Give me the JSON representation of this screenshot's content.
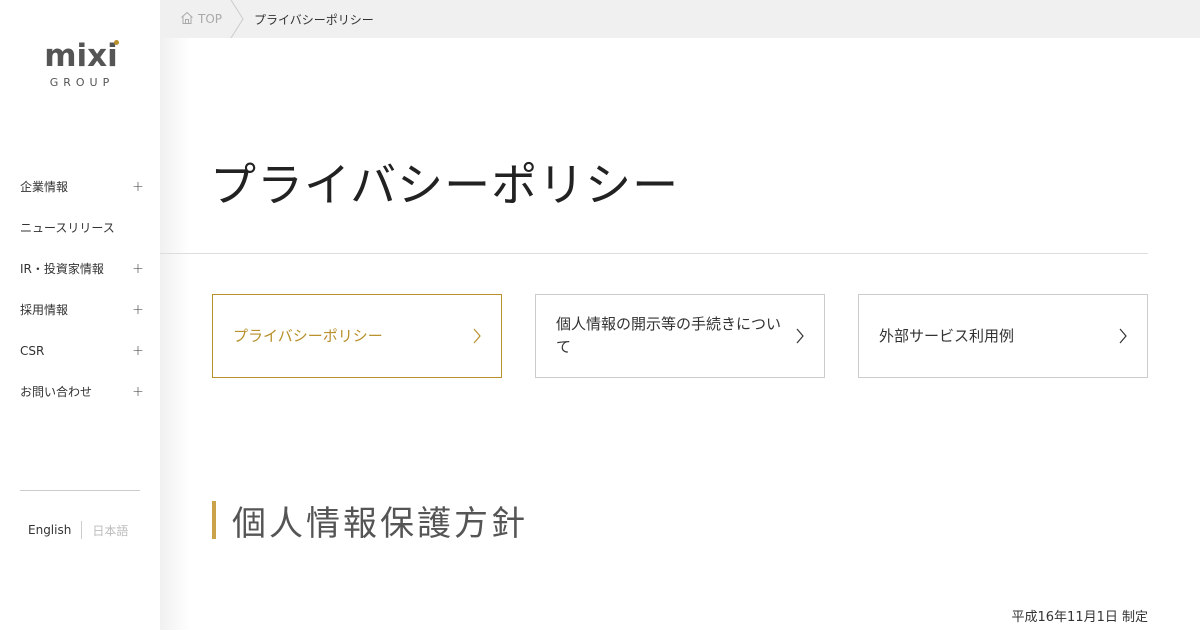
{
  "logo": {
    "main": "mixi",
    "sub": "GROUP",
    "dot_color": "#b8902c"
  },
  "sidebar": {
    "items": [
      {
        "label": "企業情報",
        "expand": "+"
      },
      {
        "label": "ニュースリリース",
        "expand": ""
      },
      {
        "label": "IR・投資家情報",
        "expand": "+"
      },
      {
        "label": "採用情報",
        "expand": "+"
      },
      {
        "label": "CSR",
        "expand": "+"
      },
      {
        "label": "お問い合わせ",
        "expand": "+"
      }
    ],
    "lang": {
      "english": "English",
      "japanese": "日本語"
    }
  },
  "breadcrumb": {
    "home_icon": "home-icon",
    "home": "TOP",
    "current": "プライバシーポリシー"
  },
  "main": {
    "title": "プライバシーポリシー",
    "tabs": [
      {
        "label": "プライバシーポリシー",
        "active": true
      },
      {
        "label": "個人情報の開示等の手続きについて",
        "active": false
      },
      {
        "label": "外部サービス利用例",
        "active": false
      }
    ],
    "section_heading": "個人情報保護方針",
    "established": "平成16年11月1日 制定"
  },
  "colors": {
    "accent": "#b8902c",
    "breadcrumb_bg": "#f0f0f0"
  }
}
